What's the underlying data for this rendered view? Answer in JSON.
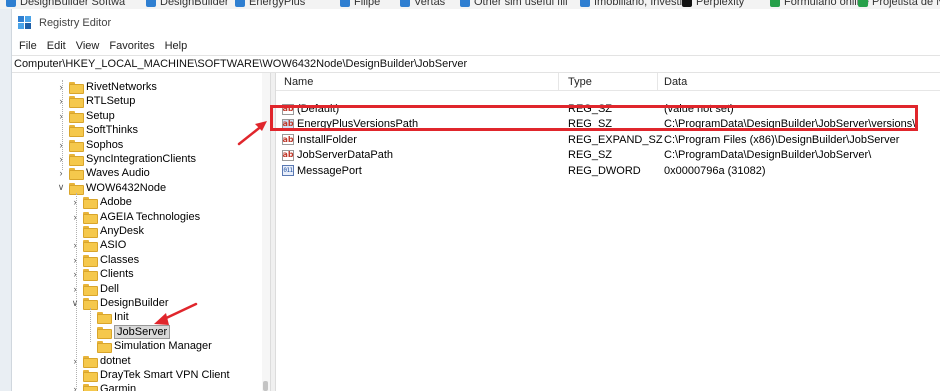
{
  "bookmarks": [
    {
      "label": "DesignBuilder Softwa",
      "color": "#2f7fd1"
    },
    {
      "label": "DesignBuilder",
      "color": "#2f7fd1"
    },
    {
      "label": "EnergyPlus",
      "color": "#2f7fd1"
    },
    {
      "label": "Filipe",
      "color": "#2f7fd1"
    },
    {
      "label": "Vertas",
      "color": "#2f7fd1"
    },
    {
      "label": "Other sim useful fill",
      "color": "#2f7fd1"
    },
    {
      "label": "Imobiliário, Investiti",
      "color": "#2f7fd1"
    },
    {
      "label": "Perplexity",
      "color": "#111111"
    },
    {
      "label": "Formulário online",
      "color": "#27a04a"
    },
    {
      "label": "Projetista de NAT",
      "color": "#27a04a"
    }
  ],
  "window": {
    "title": "Registry Editor",
    "icon": "registry-editor-icon"
  },
  "menu": [
    "File",
    "Edit",
    "View",
    "Favorites",
    "Help"
  ],
  "address": "Computer\\HKEY_LOCAL_MACHINE\\SOFTWARE\\WOW6432Node\\DesignBuilder\\JobServer",
  "tree": [
    {
      "label": "RivetNetworks",
      "level": 0,
      "expander": "collapsed"
    },
    {
      "label": "RTLSetup",
      "level": 0,
      "expander": "collapsed"
    },
    {
      "label": "Setup",
      "level": 0,
      "expander": "collapsed"
    },
    {
      "label": "SoftThinks",
      "level": 0,
      "expander": "none"
    },
    {
      "label": "Sophos",
      "level": 0,
      "expander": "collapsed"
    },
    {
      "label": "SyncIntegrationClients",
      "level": 0,
      "expander": "collapsed"
    },
    {
      "label": "Waves Audio",
      "level": 0,
      "expander": "collapsed"
    },
    {
      "label": "WOW6432Node",
      "level": 0,
      "expander": "expanded"
    },
    {
      "label": "Adobe",
      "level": 1,
      "expander": "collapsed"
    },
    {
      "label": "AGEIA Technologies",
      "level": 1,
      "expander": "collapsed"
    },
    {
      "label": "AnyDesk",
      "level": 1,
      "expander": "none"
    },
    {
      "label": "ASIO",
      "level": 1,
      "expander": "collapsed"
    },
    {
      "label": "Classes",
      "level": 1,
      "expander": "collapsed"
    },
    {
      "label": "Clients",
      "level": 1,
      "expander": "collapsed"
    },
    {
      "label": "Dell",
      "level": 1,
      "expander": "collapsed"
    },
    {
      "label": "DesignBuilder",
      "level": 1,
      "expander": "expanded"
    },
    {
      "label": "Init",
      "level": 2,
      "expander": "none"
    },
    {
      "label": "JobServer",
      "level": 2,
      "expander": "none",
      "selected": true
    },
    {
      "label": "Simulation Manager",
      "level": 2,
      "expander": "none"
    },
    {
      "label": "dotnet",
      "level": 1,
      "expander": "collapsed"
    },
    {
      "label": "DrayTek Smart VPN Client",
      "level": 1,
      "expander": "none"
    },
    {
      "label": "Garmin",
      "level": 1,
      "expander": "collapsed"
    }
  ],
  "list": {
    "columns": [
      "Name",
      "Type",
      "Data"
    ],
    "rows": [
      {
        "name": "(Default)",
        "type": "REG_SZ",
        "data": "(value not set)",
        "icon": "string-value-icon"
      },
      {
        "name": "EnergyPlusVersionsPath",
        "type": "REG_SZ",
        "data": "C:\\ProgramData\\DesignBuilder\\JobServer\\versions\\",
        "icon": "string-value-icon",
        "highlighted": true
      },
      {
        "name": "InstallFolder",
        "type": "REG_EXPAND_SZ",
        "data": "C:\\Program Files (x86)\\DesignBuilder\\JobServer",
        "icon": "string-value-icon"
      },
      {
        "name": "JobServerDataPath",
        "type": "REG_SZ",
        "data": "C:\\ProgramData\\DesignBuilder\\JobServer\\",
        "icon": "string-value-icon"
      },
      {
        "name": "MessagePort",
        "type": "REG_DWORD",
        "data": "0x0000796a (31082)",
        "icon": "binary-value-icon"
      }
    ]
  },
  "annotations": {
    "color": "#e0262c"
  },
  "icons": {
    "string": "ab",
    "binary": "011"
  }
}
